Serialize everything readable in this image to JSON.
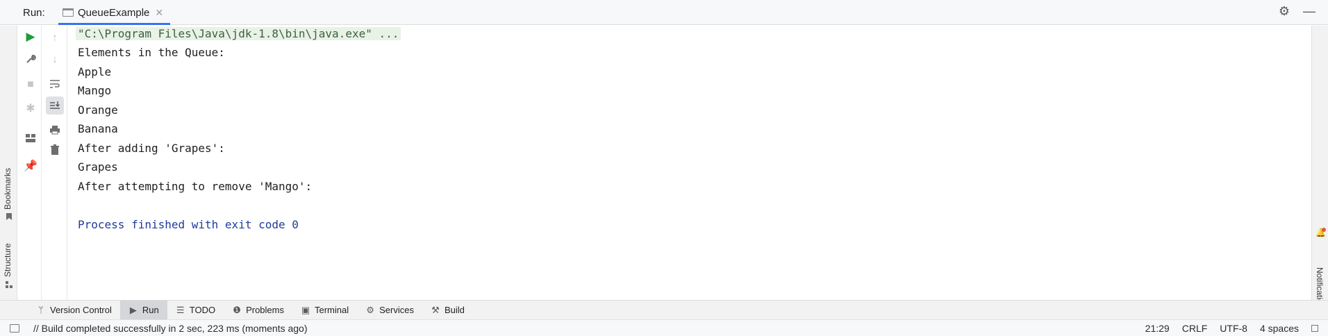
{
  "header": {
    "run_label": "Run:",
    "tab_label": "QueueExample",
    "settings_icon": "gear-icon",
    "minimize_icon": "minimize-icon"
  },
  "left_stripe": {
    "bookmarks_label": "Bookmarks",
    "structure_label": "Structure"
  },
  "console": {
    "lines": [
      "\"C:\\Program Files\\Java\\jdk-1.8\\bin\\java.exe\" ...",
      "Elements in the Queue:",
      "Apple",
      "Mango",
      "Orange",
      "Banana",
      "After adding 'Grapes':",
      "Grapes",
      "After attempting to remove 'Mango':",
      "",
      "Process finished with exit code 0"
    ]
  },
  "right_stripe": {
    "notifications_label": "Notifications"
  },
  "tool_windows": [
    {
      "label": "Version Control",
      "icon": "branch-icon"
    },
    {
      "label": "Run",
      "icon": "play-icon"
    },
    {
      "label": "TODO",
      "icon": "list-icon"
    },
    {
      "label": "Problems",
      "icon": "warning-icon"
    },
    {
      "label": "Terminal",
      "icon": "terminal-icon"
    },
    {
      "label": "Services",
      "icon": "services-icon"
    },
    {
      "label": "Build",
      "icon": "hammer-icon"
    }
  ],
  "status": {
    "message": "// Build completed successfully in 2 sec, 223 ms (moments ago)",
    "position": "21:29",
    "line_separator": "CRLF",
    "encoding": "UTF-8",
    "indent": "4 spaces"
  },
  "colors": {
    "accent": "#3574f0",
    "run_green": "#1f9d3a",
    "process_blue": "#1d3c9c",
    "command_bg": "#e8f2e6"
  }
}
